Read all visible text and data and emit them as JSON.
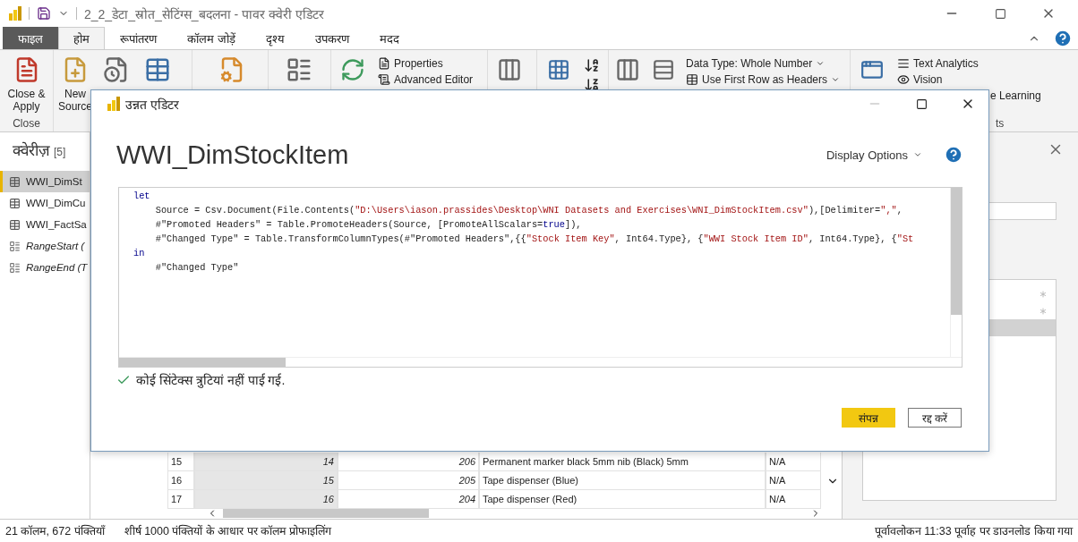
{
  "window": {
    "title": "2_2_डेटा_स्रोत_सेटिंग्स_बदलना - पावर क्वेरी एडिटर"
  },
  "menu_tabs": [
    {
      "label": "फाइल",
      "kind": "file",
      "selected": false
    },
    {
      "label": "होम",
      "kind": "tab",
      "selected": true
    },
    {
      "label": "रूपांतरण",
      "kind": "tab",
      "selected": false
    },
    {
      "label": "कॉलम जोड़ें",
      "kind": "tab",
      "selected": false
    },
    {
      "label": "दृश्य",
      "kind": "tab",
      "selected": false
    },
    {
      "label": "उपकरण",
      "kind": "tab",
      "selected": false
    },
    {
      "label": "मदद",
      "kind": "tab",
      "selected": false
    }
  ],
  "ribbon": {
    "close_apply": "Close & Apply",
    "close_group": "Close",
    "new_source": "New Source",
    "properties": "Properties",
    "advanced_editor": "Advanced Editor",
    "data_type": "Data Type: Whole Number",
    "first_row_headers": "Use First Row as Headers",
    "text_analytics": "Text Analytics",
    "vision": "Vision",
    "machine_learning": "e Learning",
    "ai_group": "ts"
  },
  "queries": {
    "title": "क्वेरीज़",
    "count": "[5]",
    "items": [
      {
        "name": "WWI_DimSt",
        "kind": "table",
        "selected": true
      },
      {
        "name": "WWI_DimCu",
        "kind": "table",
        "selected": false
      },
      {
        "name": "WWI_FactSa",
        "kind": "table",
        "selected": false
      },
      {
        "name": "RangeStart (",
        "kind": "parameter",
        "selected": false
      },
      {
        "name": "RangeEnd (T",
        "kind": "parameter",
        "selected": false
      }
    ]
  },
  "grid": {
    "rows": [
      {
        "row": "15",
        "column_1": "14",
        "column_2": "206",
        "column_3": "Permanent marker black 5mm nib (Black) 5mm",
        "column_4": "N/A"
      },
      {
        "row": "16",
        "column_1": "15",
        "column_2": "205",
        "column_3": "Tape dispenser (Blue)",
        "column_4": "N/A"
      },
      {
        "row": "17",
        "column_1": "16",
        "column_2": "204",
        "column_3": "Tape dispenser (Red)",
        "column_4": "N/A"
      }
    ]
  },
  "applied_steps": [
    {
      "selected": false
    },
    {
      "selected": false
    },
    {
      "selected": true
    }
  ],
  "dialog": {
    "title": "उन्नत एडिटर",
    "query_name": "WWI_DimStockItem",
    "display_options": "Display Options",
    "code_lines": [
      [
        {
          "text": "let",
          "kind": "keyword"
        }
      ],
      [
        {
          "text": "    Source = Csv.Document(File.Contents(",
          "kind": "plain"
        },
        {
          "text": "\"D:\\Users\\iason.prassides\\Desktop\\WNI Datasets and Exercises\\WNI_DimStockItem.csv\"",
          "kind": "string"
        },
        {
          "text": "),[Delimiter=",
          "kind": "plain"
        },
        {
          "text": "\",\"",
          "kind": "string"
        },
        {
          "text": ",",
          "kind": "plain"
        }
      ],
      [
        {
          "text": "    #\"Promoted Headers\" = Table.PromoteHeaders(Source, [PromoteAllScalars=",
          "kind": "plain"
        },
        {
          "text": "true",
          "kind": "keyword"
        },
        {
          "text": "]),",
          "kind": "plain"
        }
      ],
      [
        {
          "text": "    #\"Changed Type\" = Table.TransformColumnTypes(#\"Promoted Headers\",{{",
          "kind": "plain"
        },
        {
          "text": "\"Stock Item Key\"",
          "kind": "string"
        },
        {
          "text": ", Int64.Type}, {",
          "kind": "plain"
        },
        {
          "text": "\"WWI Stock Item ID\"",
          "kind": "string"
        },
        {
          "text": ", Int64.Type}, {",
          "kind": "plain"
        },
        {
          "text": "\"St",
          "kind": "string"
        }
      ],
      [
        {
          "text": "in",
          "kind": "keyword"
        }
      ],
      [
        {
          "text": "    #\"Changed Type\"",
          "kind": "plain"
        }
      ]
    ],
    "message": "कोई सिंटेक्स त्रुटियां नहीं पाई गई.",
    "buttons": [
      {
        "label": "संपन्न",
        "kind": "primary"
      },
      {
        "label": "रद्द करें",
        "kind": "secondary"
      }
    ]
  },
  "status_bar": {
    "columns_rows": "21 कॉलम, 672 पंक्तियाँ",
    "profiling": "शीर्ष 1000 पंक्तियों के आधार पर कॉलम प्रोफाइलिंग",
    "preview": "पूर्वावलोकन 11:33 पूर्वाह पर डाउनलोड किया गया"
  }
}
